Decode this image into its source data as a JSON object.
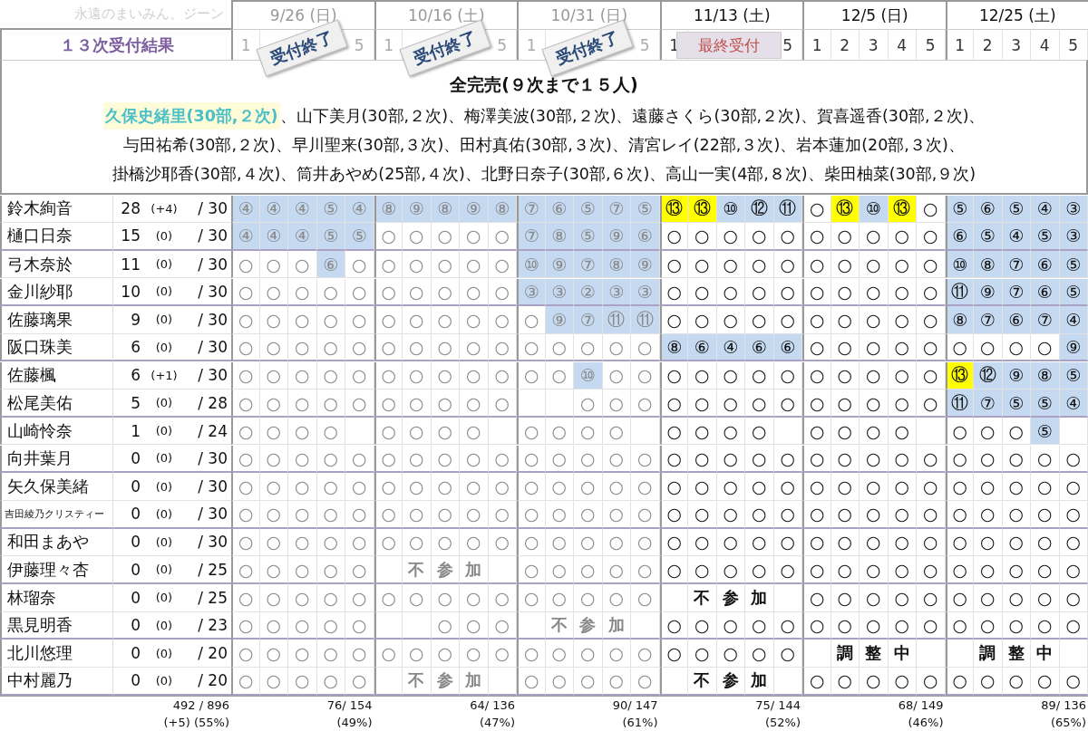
{
  "caption": "永遠のまいみん、ジーン",
  "title": "１３次受付結果",
  "dates": [
    {
      "date": "9/26 (日)",
      "parts": [
        "1",
        "5"
      ],
      "stamp": {
        "kind": "closed",
        "text": "受付終了"
      },
      "total": "76/ 154",
      "percent": "(49%)"
    },
    {
      "date": "10/16 (土)",
      "parts": [
        "1",
        "5"
      ],
      "stamp": {
        "kind": "closed",
        "text": "受付終了"
      },
      "total": "64/ 136",
      "percent": "(47%)"
    },
    {
      "date": "10/31 (日)",
      "parts": [
        "1",
        "5"
      ],
      "stamp": {
        "kind": "closed",
        "text": "受付終了"
      },
      "total": "90/ 147",
      "percent": "(61%)"
    },
    {
      "date": "11/13 (土)",
      "parts": [
        "1",
        "5"
      ],
      "stamp": {
        "kind": "last",
        "text": "最終受付"
      },
      "total": "75/ 144",
      "percent": "(52%)"
    },
    {
      "date": "12/5 (日)",
      "parts": [
        "1",
        "2",
        "3",
        "4",
        "5"
      ],
      "total": "68/ 149",
      "percent": "(46%)"
    },
    {
      "date": "12/25 (土)",
      "parts": [
        "1",
        "2",
        "3",
        "4",
        "5"
      ],
      "total": "89/ 136",
      "percent": "(65%)"
    }
  ],
  "notice": {
    "headline": "全完売(９次まで１５人)",
    "lines": [
      [
        {
          "text": "久保史緒里(30部,２次)",
          "highlighted": true
        },
        {
          "text": "、山下美月(30部,２次)、梅澤美波(30部,２次)、遠藤さくら(30部,２次)、賀喜遥香(30部,２次)、",
          "highlighted": false
        }
      ],
      [
        {
          "text": "与田祐希(30部,２次)、早川聖来(30部,３次)、田村真佑(30部,３次)、清宮レイ(22部,３次)、岩本蓮加(20部,３次)、",
          "highlighted": false
        }
      ],
      [
        {
          "text": "掛橋沙耶香(30部,４次)、筒井あやめ(25部,４次)、北野日奈子(30部,６次)、高山一実(4部,８次)、柴田柚菜(30部,９次)",
          "highlighted": false
        }
      ]
    ]
  },
  "rows": [
    {
      "name": "鈴木絢音",
      "count": "28",
      "delta": "(+4)",
      "limit": "/ 30",
      "cells": [
        {
          "kind": "pick",
          "text": "④",
          "color": "#c5d9f1"
        },
        {
          "kind": "pick",
          "text": "④",
          "color": "#c5d9f1"
        },
        {
          "kind": "pick",
          "text": "④",
          "color": "#c5d9f1"
        },
        {
          "kind": "pick",
          "text": "⑤",
          "color": "#c5d9f1"
        },
        {
          "kind": "pick",
          "text": "④",
          "color": "#c5d9f1"
        },
        {
          "kind": "pick",
          "text": "⑧",
          "color": "#c5d9f1"
        },
        {
          "kind": "pick",
          "text": "⑨",
          "color": "#c5d9f1"
        },
        {
          "kind": "pick",
          "text": "⑧",
          "color": "#c5d9f1"
        },
        {
          "kind": "pick",
          "text": "⑨",
          "color": "#c5d9f1"
        },
        {
          "kind": "pick",
          "text": "⑧",
          "color": "#c5d9f1"
        },
        {
          "kind": "pick",
          "text": "⑦",
          "color": "#c5d9f1"
        },
        {
          "kind": "pick",
          "text": "⑥",
          "color": "#c5d9f1"
        },
        {
          "kind": "pick",
          "text": "⑤",
          "color": "#c5d9f1"
        },
        {
          "kind": "pick",
          "text": "⑦",
          "color": "#c5d9f1"
        },
        {
          "kind": "pick",
          "text": "⑤",
          "color": "#c5d9f1"
        },
        {
          "kind": "pick",
          "text": "⑬",
          "color": "#ffff00"
        },
        {
          "kind": "pick",
          "text": "⑬",
          "color": "#ffff00"
        },
        {
          "kind": "pick",
          "text": "⑩",
          "color": "#c5d9f1"
        },
        {
          "kind": "pick",
          "text": "⑫",
          "color": "#c5d9f1"
        },
        {
          "kind": "pick",
          "text": "⑪",
          "color": "#c5d9f1"
        },
        "○",
        {
          "kind": "pick",
          "text": "⑬",
          "color": "#ffff00"
        },
        {
          "kind": "pick",
          "text": "⑩",
          "color": "#c5d9f1"
        },
        {
          "kind": "pick",
          "text": "⑬",
          "color": "#ffff00"
        },
        "○",
        {
          "kind": "pick",
          "text": "⑤",
          "color": "#c5d9f1"
        },
        {
          "kind": "pick",
          "text": "⑥",
          "color": "#c5d9f1"
        },
        {
          "kind": "pick",
          "text": "⑤",
          "color": "#c5d9f1"
        },
        {
          "kind": "pick",
          "text": "④",
          "color": "#c5d9f1"
        },
        {
          "kind": "pick",
          "text": "③",
          "color": "#c5d9f1"
        }
      ]
    },
    {
      "name": "樋口日奈",
      "count": "15",
      "delta": "(0)",
      "limit": "/ 30",
      "cells": [
        {
          "kind": "pick",
          "text": "④",
          "color": "#c5d9f1"
        },
        {
          "kind": "pick",
          "text": "④",
          "color": "#c5d9f1"
        },
        {
          "kind": "pick",
          "text": "④",
          "color": "#c5d9f1"
        },
        {
          "kind": "pick",
          "text": "⑤",
          "color": "#c5d9f1"
        },
        {
          "kind": "pick",
          "text": "⑤",
          "color": "#c5d9f1"
        },
        "○",
        "○",
        "○",
        "○",
        "○",
        {
          "kind": "pick",
          "text": "⑦",
          "color": "#c5d9f1"
        },
        {
          "kind": "pick",
          "text": "⑧",
          "color": "#c5d9f1"
        },
        {
          "kind": "pick",
          "text": "⑤",
          "color": "#c5d9f1"
        },
        {
          "kind": "pick",
          "text": "⑨",
          "color": "#c5d9f1"
        },
        {
          "kind": "pick",
          "text": "⑥",
          "color": "#c5d9f1"
        },
        "○",
        "○",
        "○",
        "○",
        "○",
        "○",
        "○",
        "○",
        "○",
        "○",
        {
          "kind": "pick",
          "text": "⑥",
          "color": "#c5d9f1"
        },
        {
          "kind": "pick",
          "text": "⑤",
          "color": "#c5d9f1"
        },
        {
          "kind": "pick",
          "text": "④",
          "color": "#c5d9f1"
        },
        {
          "kind": "pick",
          "text": "⑤",
          "color": "#c5d9f1"
        },
        {
          "kind": "pick",
          "text": "③",
          "color": "#c5d9f1"
        }
      ]
    },
    {
      "name": "弓木奈於",
      "count": "11",
      "delta": "(0)",
      "limit": "/ 30",
      "cells": [
        "○",
        "○",
        "○",
        {
          "kind": "pick",
          "text": "⑥",
          "color": "#c5d9f1"
        },
        "○",
        "○",
        "○",
        "○",
        "○",
        "○",
        {
          "kind": "pick",
          "text": "⑩",
          "color": "#c5d9f1"
        },
        {
          "kind": "pick",
          "text": "⑨",
          "color": "#c5d9f1"
        },
        {
          "kind": "pick",
          "text": "⑦",
          "color": "#c5d9f1"
        },
        {
          "kind": "pick",
          "text": "⑧",
          "color": "#c5d9f1"
        },
        {
          "kind": "pick",
          "text": "⑨",
          "color": "#c5d9f1"
        },
        "○",
        "○",
        "○",
        "○",
        "○",
        "○",
        "○",
        "○",
        "○",
        "○",
        {
          "kind": "pick",
          "text": "⑩",
          "color": "#c5d9f1"
        },
        {
          "kind": "pick",
          "text": "⑧",
          "color": "#c5d9f1"
        },
        {
          "kind": "pick",
          "text": "⑦",
          "color": "#c5d9f1"
        },
        {
          "kind": "pick",
          "text": "⑥",
          "color": "#c5d9f1"
        },
        {
          "kind": "pick",
          "text": "⑤",
          "color": "#c5d9f1"
        }
      ]
    },
    {
      "name": "金川紗耶",
      "count": "10",
      "delta": "(0)",
      "limit": "/ 30",
      "cells": [
        "○",
        "○",
        "○",
        "○",
        "○",
        "○",
        "○",
        "○",
        "○",
        "○",
        {
          "kind": "pick",
          "text": "③",
          "color": "#c5d9f1"
        },
        {
          "kind": "pick",
          "text": "③",
          "color": "#c5d9f1"
        },
        {
          "kind": "pick",
          "text": "②",
          "color": "#c5d9f1"
        },
        {
          "kind": "pick",
          "text": "③",
          "color": "#c5d9f1"
        },
        {
          "kind": "pick",
          "text": "③",
          "color": "#c5d9f1"
        },
        "○",
        "○",
        "○",
        "○",
        "○",
        "○",
        "○",
        "○",
        "○",
        "○",
        {
          "kind": "pick",
          "text": "⑪",
          "color": "#c5d9f1"
        },
        {
          "kind": "pick",
          "text": "⑨",
          "color": "#c5d9f1"
        },
        {
          "kind": "pick",
          "text": "⑦",
          "color": "#c5d9f1"
        },
        {
          "kind": "pick",
          "text": "⑥",
          "color": "#c5d9f1"
        },
        {
          "kind": "pick",
          "text": "⑤",
          "color": "#c5d9f1"
        }
      ]
    },
    {
      "name": "佐藤璃果",
      "count": "9",
      "delta": "(0)",
      "limit": "/ 30",
      "cells": [
        "○",
        "○",
        "○",
        "○",
        "○",
        "○",
        "○",
        "○",
        "○",
        "○",
        "○",
        {
          "kind": "pick",
          "text": "⑨",
          "color": "#c5d9f1"
        },
        {
          "kind": "pick",
          "text": "⑦",
          "color": "#c5d9f1"
        },
        {
          "kind": "pick",
          "text": "⑪",
          "color": "#c5d9f1"
        },
        {
          "kind": "pick",
          "text": "⑪",
          "color": "#c5d9f1"
        },
        "○",
        "○",
        "○",
        "○",
        "○",
        "○",
        "○",
        "○",
        "○",
        "○",
        {
          "kind": "pick",
          "text": "⑧",
          "color": "#c5d9f1"
        },
        {
          "kind": "pick",
          "text": "⑦",
          "color": "#c5d9f1"
        },
        {
          "kind": "pick",
          "text": "⑥",
          "color": "#c5d9f1"
        },
        {
          "kind": "pick",
          "text": "⑦",
          "color": "#c5d9f1"
        },
        {
          "kind": "pick",
          "text": "④",
          "color": "#c5d9f1"
        }
      ]
    },
    {
      "name": "阪口珠美",
      "count": "6",
      "delta": "(0)",
      "limit": "/ 30",
      "cells": [
        "○",
        "○",
        "○",
        "○",
        "○",
        "○",
        "○",
        "○",
        "○",
        "○",
        "○",
        "○",
        "○",
        "○",
        "○",
        {
          "kind": "pick",
          "text": "⑧",
          "color": "#c5d9f1"
        },
        {
          "kind": "pick",
          "text": "⑥",
          "color": "#c5d9f1"
        },
        {
          "kind": "pick",
          "text": "④",
          "color": "#c5d9f1"
        },
        {
          "kind": "pick",
          "text": "⑥",
          "color": "#c5d9f1"
        },
        {
          "kind": "pick",
          "text": "⑥",
          "color": "#c5d9f1"
        },
        "○",
        "○",
        "○",
        "○",
        "○",
        "○",
        "○",
        "○",
        "○",
        {
          "kind": "pick",
          "text": "⑨",
          "color": "#c5d9f1"
        }
      ]
    },
    {
      "name": "佐藤楓",
      "count": "6",
      "delta": "(+1)",
      "limit": "/ 30",
      "cells": [
        "○",
        "○",
        "○",
        "○",
        "○",
        "○",
        "○",
        "○",
        "○",
        "○",
        "○",
        "○",
        {
          "kind": "pick",
          "text": "⑩",
          "color": "#c5d9f1"
        },
        "○",
        "○",
        "○",
        "○",
        "○",
        "○",
        "○",
        "○",
        "○",
        "○",
        "○",
        "○",
        {
          "kind": "pick",
          "text": "⑬",
          "color": "#ffff00"
        },
        {
          "kind": "pick",
          "text": "⑫",
          "color": "#c5d9f1"
        },
        {
          "kind": "pick",
          "text": "⑨",
          "color": "#c5d9f1"
        },
        {
          "kind": "pick",
          "text": "⑧",
          "color": "#c5d9f1"
        },
        {
          "kind": "pick",
          "text": "⑤",
          "color": "#c5d9f1"
        }
      ]
    },
    {
      "name": "松尾美佑",
      "count": "5",
      "delta": "(0)",
      "limit": "/ 28",
      "cells": [
        "○",
        "○",
        "○",
        "○",
        "○",
        "○",
        "○",
        "○",
        "○",
        "○",
        null,
        null,
        "○",
        "○",
        "○",
        "○",
        "○",
        "○",
        "○",
        "○",
        "○",
        "○",
        "○",
        "○",
        "○",
        {
          "kind": "pick",
          "text": "⑪",
          "color": "#c5d9f1"
        },
        {
          "kind": "pick",
          "text": "⑦",
          "color": "#c5d9f1"
        },
        {
          "kind": "pick",
          "text": "⑤",
          "color": "#c5d9f1"
        },
        {
          "kind": "pick",
          "text": "⑤",
          "color": "#c5d9f1"
        },
        {
          "kind": "pick",
          "text": "④",
          "color": "#c5d9f1"
        }
      ]
    },
    {
      "name": "山崎怜奈",
      "count": "1",
      "delta": "(0)",
      "limit": "/ 24",
      "cells": [
        "○",
        "○",
        "○",
        "○",
        null,
        "○",
        "○",
        "○",
        "○",
        null,
        "○",
        "○",
        "○",
        "○",
        null,
        "○",
        "○",
        "○",
        "○",
        null,
        "○",
        "○",
        "○",
        "○",
        null,
        "○",
        "○",
        "○",
        {
          "kind": "pick",
          "text": "⑤",
          "color": "#c5d9f1"
        },
        null
      ]
    },
    {
      "name": "向井葉月",
      "count": "0",
      "delta": "(0)",
      "limit": "/ 30",
      "cells": [
        "○",
        "○",
        "○",
        "○",
        "○",
        "○",
        "○",
        "○",
        "○",
        "○",
        "○",
        "○",
        "○",
        "○",
        "○",
        "○",
        "○",
        "○",
        "○",
        "○",
        "○",
        "○",
        "○",
        "○",
        "○",
        "○",
        "○",
        "○",
        "○",
        "○"
      ]
    },
    {
      "name": "矢久保美緒",
      "count": "0",
      "delta": "(0)",
      "limit": "/ 30",
      "cells": [
        "○",
        "○",
        "○",
        "○",
        "○",
        "○",
        "○",
        "○",
        "○",
        "○",
        "○",
        "○",
        "○",
        "○",
        "○",
        "○",
        "○",
        "○",
        "○",
        "○",
        "○",
        "○",
        "○",
        "○",
        "○",
        "○",
        "○",
        "○",
        "○",
        "○"
      ]
    },
    {
      "name": "吉田綾乃クリスティー",
      "count": "0",
      "delta": "(0)",
      "limit": "/ 30",
      "cells": [
        "○",
        "○",
        "○",
        "○",
        "○",
        "○",
        "○",
        "○",
        "○",
        "○",
        "○",
        "○",
        "○",
        "○",
        "○",
        "○",
        "○",
        "○",
        "○",
        "○",
        "○",
        "○",
        "○",
        "○",
        "○",
        "○",
        "○",
        "○",
        "○",
        "○"
      ]
    },
    {
      "name": "和田まあや",
      "count": "0",
      "delta": "(0)",
      "limit": "/ 30",
      "cells": [
        "○",
        "○",
        "○",
        "○",
        "○",
        "○",
        "○",
        "○",
        "○",
        "○",
        "○",
        "○",
        "○",
        "○",
        "○",
        "○",
        "○",
        "○",
        "○",
        "○",
        "○",
        "○",
        "○",
        "○",
        "○",
        "○",
        "○",
        "○",
        "○",
        "○"
      ]
    },
    {
      "name": "伊藤理々杏",
      "count": "0",
      "delta": "(0)",
      "limit": "/ 25",
      "cells": [
        "○",
        "○",
        "○",
        "○",
        "○",
        null,
        {
          "kind": "note",
          "text": "不"
        },
        {
          "kind": "note",
          "text": "参"
        },
        {
          "kind": "note",
          "text": "加"
        },
        null,
        "○",
        "○",
        "○",
        "○",
        "○",
        "○",
        "○",
        "○",
        "○",
        "○",
        "○",
        "○",
        "○",
        "○",
        "○",
        "○",
        "○",
        "○",
        "○",
        "○"
      ]
    },
    {
      "name": "林瑠奈",
      "count": "0",
      "delta": "(0)",
      "limit": "/ 25",
      "cells": [
        "○",
        "○",
        "○",
        "○",
        "○",
        "○",
        "○",
        "○",
        "○",
        "○",
        "○",
        "○",
        "○",
        "○",
        "○",
        null,
        {
          "kind": "note",
          "text": "不"
        },
        {
          "kind": "note",
          "text": "参"
        },
        {
          "kind": "note",
          "text": "加"
        },
        null,
        "○",
        "○",
        "○",
        "○",
        "○",
        "○",
        "○",
        "○",
        "○",
        "○"
      ]
    },
    {
      "name": "黒見明香",
      "count": "0",
      "delta": "(0)",
      "limit": "/ 23",
      "cells": [
        "○",
        "○",
        "○",
        "○",
        "○",
        null,
        null,
        "○",
        "○",
        "○",
        null,
        {
          "kind": "note",
          "text": "不"
        },
        {
          "kind": "note",
          "text": "参"
        },
        {
          "kind": "note",
          "text": "加"
        },
        null,
        "○",
        "○",
        "○",
        "○",
        "○",
        "○",
        "○",
        "○",
        "○",
        "○",
        "○",
        "○",
        "○",
        "○",
        "○"
      ]
    },
    {
      "name": "北川悠理",
      "count": "0",
      "delta": "(0)",
      "limit": "/ 20",
      "cells": [
        "○",
        "○",
        "○",
        "○",
        "○",
        "○",
        "○",
        "○",
        "○",
        "○",
        "○",
        "○",
        "○",
        "○",
        "○",
        "○",
        "○",
        "○",
        "○",
        "○",
        null,
        {
          "kind": "note",
          "text": "調"
        },
        {
          "kind": "note",
          "text": "整"
        },
        {
          "kind": "note",
          "text": "中"
        },
        null,
        null,
        {
          "kind": "note",
          "text": "調"
        },
        {
          "kind": "note",
          "text": "整"
        },
        {
          "kind": "note",
          "text": "中"
        },
        null
      ]
    },
    {
      "name": "中村麗乃",
      "count": "0",
      "delta": "(0)",
      "limit": "/ 20",
      "cells": [
        "○",
        "○",
        "○",
        "○",
        "○",
        null,
        {
          "kind": "note",
          "text": "不"
        },
        {
          "kind": "note",
          "text": "参"
        },
        {
          "kind": "note",
          "text": "加"
        },
        null,
        "○",
        "○",
        "○",
        "○",
        "○",
        null,
        {
          "kind": "note",
          "text": "不"
        },
        {
          "kind": "note",
          "text": "参"
        },
        {
          "kind": "note",
          "text": "加"
        },
        null,
        "○",
        "○",
        "○",
        "○",
        "○",
        "○",
        "○",
        "○",
        "○",
        "○"
      ]
    }
  ],
  "totals": {
    "total": "492 / 896",
    "percent": "(+5) (55%)"
  }
}
